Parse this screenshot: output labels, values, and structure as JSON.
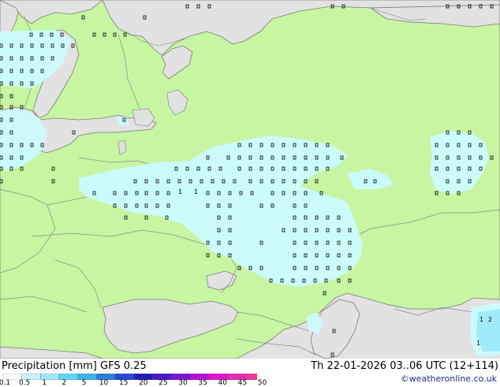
{
  "footer": {
    "legend_title": "Precipitation [mm]  GFS 0.25",
    "run_info": "Th 22-01-2026 03..06 UTC (12+114)",
    "credit": "©weatheronline.co.uk"
  },
  "scale": {
    "labels": [
      "0.1",
      "0.5",
      "1",
      "2",
      "5",
      "10",
      "15",
      "20",
      "25",
      "30",
      "35",
      "40",
      "45",
      "50"
    ],
    "colors": [
      "#ffffff",
      "#c6f5fb",
      "#9be9fa",
      "#5fd6f5",
      "#3cb2e9",
      "#2d7de0",
      "#2748d8",
      "#1c1fb6",
      "#4b19c8",
      "#7c15d6",
      "#b811d6",
      "#e016d0",
      "#e629b4",
      "#ee3a9d"
    ]
  },
  "map_colors": {
    "land": "#c7f5a2",
    "sea": "#e2e2e2",
    "precip": "#ccfbff",
    "border": "#8a8a8a",
    "coast": "#7a7a7a"
  },
  "map_labels": {
    "value_one": "1",
    "value_two": "2"
  }
}
